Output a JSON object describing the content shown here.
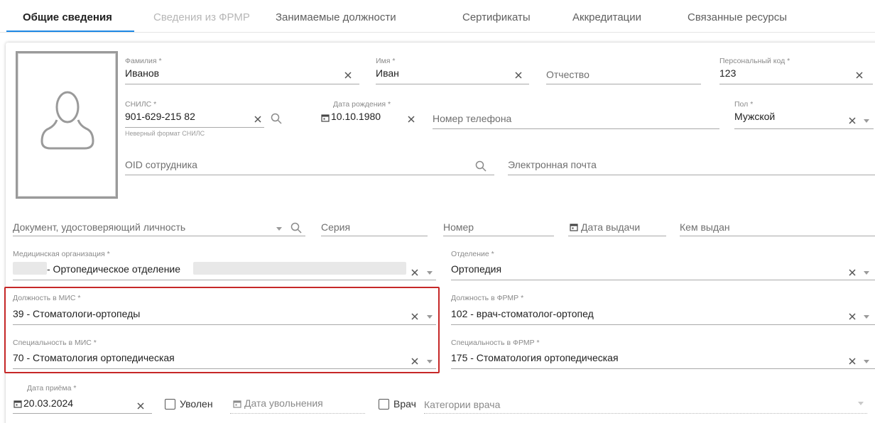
{
  "tabs": [
    {
      "label": "Общие сведения"
    },
    {
      "label": "Сведения из ФРМР"
    },
    {
      "label": "Занимаемые должности"
    },
    {
      "label": "Сертификаты"
    },
    {
      "label": "Аккредитации"
    },
    {
      "label": "Связанные ресурсы"
    }
  ],
  "fields": {
    "surname": {
      "label": "Фамилия *",
      "value": "Иванов"
    },
    "name": {
      "label": "Имя *",
      "value": "Иван"
    },
    "patronymic": {
      "placeholder": "Отчество"
    },
    "personal_code": {
      "label": "Персональный код *",
      "value": "123"
    },
    "snils": {
      "label": "СНИЛС *",
      "value": "901-629-215 82",
      "error": "Неверный формат СНИЛС"
    },
    "birth_date": {
      "label": "Дата рождения *",
      "value": "10.10.1980"
    },
    "phone": {
      "placeholder": "Номер телефона"
    },
    "gender": {
      "label": "Пол *",
      "value": "Мужской"
    },
    "oid": {
      "placeholder": "OID сотрудника"
    },
    "email": {
      "placeholder": "Электронная почта"
    },
    "id_document": {
      "placeholder": "Документ, удостоверяющий личность"
    },
    "series": {
      "placeholder": "Серия"
    },
    "number": {
      "placeholder": "Номер"
    },
    "issue_date": {
      "placeholder": "Дата выдачи"
    },
    "issued_by": {
      "placeholder": "Кем выдан"
    },
    "med_org": {
      "label": "Медицинская организация *",
      "value": "- Ортопедическое отделение"
    },
    "department": {
      "label": "Отделение *",
      "value": "Ортопедия"
    },
    "mis_position": {
      "label": "Должность в МИС *",
      "value": "39 - Стоматологи-ортопеды"
    },
    "frmr_position": {
      "label": "Должность в ФРМР *",
      "value": "102 - врач-стоматолог-ортопед"
    },
    "mis_specialty": {
      "label": "Специальность в МИС *",
      "value": "70 - Стоматология ортопедическая"
    },
    "frmr_specialty": {
      "label": "Специальность в ФРМР *",
      "value": "175 - Стоматология ортопедическая"
    },
    "hire_date": {
      "label": "Дата приёма *",
      "value": "20.03.2024"
    },
    "dismissed": {
      "label": "Уволен"
    },
    "dismissal_date": {
      "placeholder": "Дата увольнения"
    },
    "doctor": {
      "label": "Врач"
    },
    "doctor_category": {
      "placeholder": "Категории врача"
    }
  },
  "colors": {
    "accent": "#1e88e5",
    "highlight": "#c62828"
  }
}
